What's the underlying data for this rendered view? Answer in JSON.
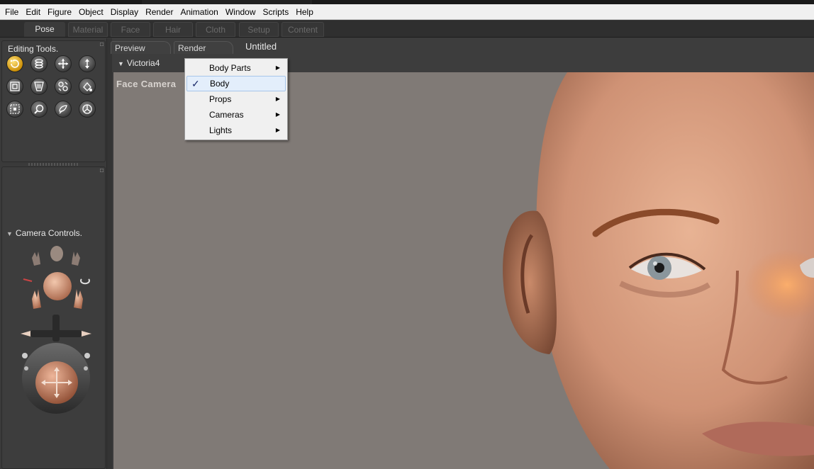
{
  "menubar": {
    "items": [
      "File",
      "Edit",
      "Figure",
      "Object",
      "Display",
      "Render",
      "Animation",
      "Window",
      "Scripts",
      "Help"
    ]
  },
  "rooms": {
    "tabs": [
      {
        "label": "Pose",
        "active": true
      },
      {
        "label": "Material",
        "active": false
      },
      {
        "label": "Face",
        "active": false
      },
      {
        "label": "Hair",
        "active": false
      },
      {
        "label": "Cloth",
        "active": false
      },
      {
        "label": "Setup",
        "active": false
      },
      {
        "label": "Content",
        "active": false
      }
    ]
  },
  "editing_tools": {
    "title": "Editing Tools.",
    "icons": [
      "rotate-icon",
      "twist-icon",
      "translate-icon",
      "translate-in-out-icon",
      "scale-icon",
      "taper-icon",
      "chain-break-icon",
      "color-icon",
      "grouping-icon",
      "view-magnifier-icon",
      "morph-brush-icon",
      "direct-manipulation-icon"
    ]
  },
  "camera_controls": {
    "title": "Camera Controls."
  },
  "view": {
    "tabs": [
      "Preview",
      "Render"
    ],
    "document_title": "Untitled",
    "figure_selector": "Victoria4",
    "camera_label": "Face Camera"
  },
  "dropdown": {
    "items": [
      {
        "label": "Body Parts",
        "submenu": true,
        "checked": false,
        "highlighted": false
      },
      {
        "label": "Body",
        "submenu": false,
        "checked": true,
        "highlighted": true
      },
      {
        "label": "Props",
        "submenu": true,
        "checked": false,
        "highlighted": false
      },
      {
        "label": "Cameras",
        "submenu": true,
        "checked": false,
        "highlighted": false
      },
      {
        "label": "Lights",
        "submenu": true,
        "checked": false,
        "highlighted": false
      }
    ]
  },
  "colors": {
    "viewport_bg": "#807a76",
    "panel_bg": "#3a3a3a",
    "tool_selected": "#e3a900",
    "skin": "#d9a07c"
  }
}
